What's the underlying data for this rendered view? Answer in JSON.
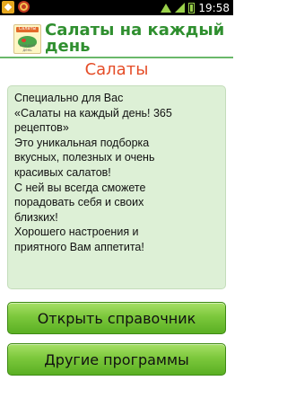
{
  "status_bar": {
    "time": "19:58",
    "icons": [
      "notification-icon",
      "app-icon",
      "wifi-icon",
      "signal-icon",
      "battery-icon"
    ]
  },
  "header": {
    "logo_text": "Салаты",
    "logo_subtext": "каждый день",
    "title": "Салаты на каждый день"
  },
  "section": {
    "title": "Салаты"
  },
  "card": {
    "lines": [
      "Специально для Вас",
      "«Салаты на каждый день! 365",
      "рецептов»",
      "Это уникальная подборка",
      "вкусных, полезных и очень",
      "красивых салатов!",
      "С ней вы всегда сможете",
      "порадовать себя и своих",
      "близких!",
      "Хорошего настроения и",
      "приятного Вам аппетита!"
    ]
  },
  "buttons": {
    "open_label": "Открыть справочник",
    "other_label": "Другие программы"
  },
  "colors": {
    "title_green": "#2f8f2f",
    "section_orange": "#e54d28",
    "card_bg": "#ddf0d6",
    "button_green": "#7cc83c"
  }
}
